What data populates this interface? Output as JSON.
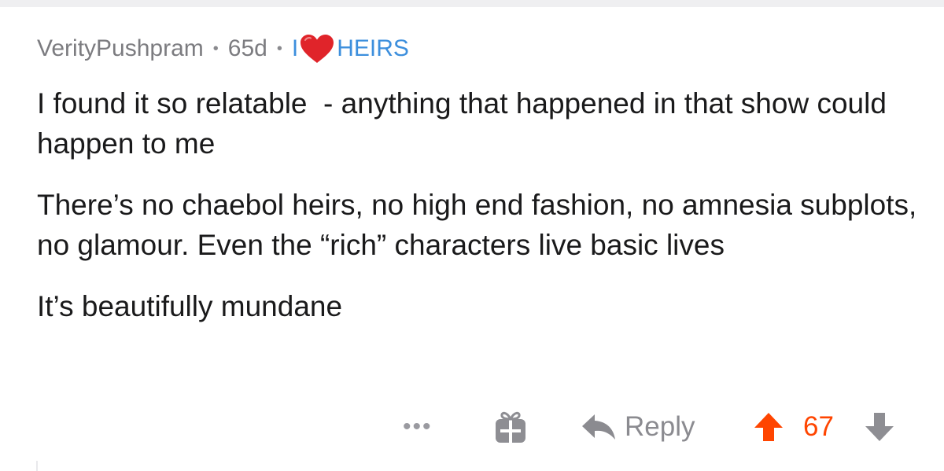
{
  "comment": {
    "author": "VerityPushpram",
    "separator": "•",
    "age": "65d",
    "flair": {
      "prefix": "I",
      "heart_icon": "red-heart-emoji",
      "text": "HEIRS"
    },
    "paragraphs": [
      "I found it so relatable  - anything that happened in that show could happen to me",
      "There’s no chaebol heirs, no high end fashion, no amnesia subplots, no glamour. Even the “rich” characters live basic lives",
      "It’s beautifully mundane"
    ]
  },
  "actions": {
    "more_label": "•••",
    "gift_icon": "gift-icon",
    "reply_icon": "reply-arrow-icon",
    "reply_label": "Reply",
    "upvote_icon": "upvote-arrow-icon",
    "score": "67",
    "downvote_icon": "downvote-arrow-icon"
  },
  "colors": {
    "meta_gray": "#7c7c80",
    "flair_blue": "#3d8fdd",
    "heart_red": "#e0242a",
    "upvote_orange": "#ff4500",
    "body_text": "#1a1a1b"
  }
}
